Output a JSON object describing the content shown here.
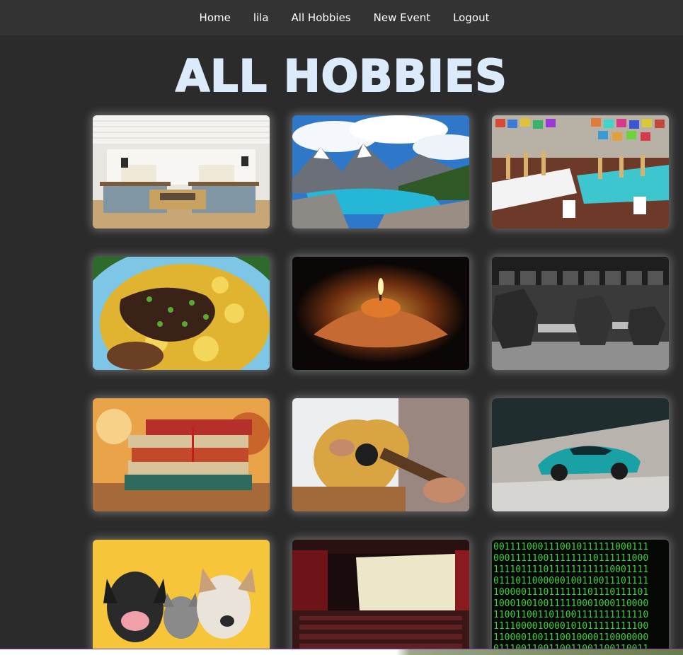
{
  "nav": {
    "items": [
      {
        "label": "Home"
      },
      {
        "label": "lila"
      },
      {
        "label": "All Hobbies"
      },
      {
        "label": "New Event"
      },
      {
        "label": "Logout"
      }
    ]
  },
  "page": {
    "title": "ALL HOBBIES"
  },
  "hobbies": [
    {
      "image": "kitchen"
    },
    {
      "image": "mountain-lake"
    },
    {
      "image": "painting-studio"
    },
    {
      "image": "food-plate"
    },
    {
      "image": "candle-hands"
    },
    {
      "image": "dumbbells"
    },
    {
      "image": "books"
    },
    {
      "image": "guitar"
    },
    {
      "image": "sports-car"
    },
    {
      "image": "pets"
    },
    {
      "image": "cinema"
    },
    {
      "image": "binary-code"
    }
  ],
  "colors": {
    "background": "#2b2b2b",
    "navbar": "#333333",
    "title": "#dcebfb"
  }
}
